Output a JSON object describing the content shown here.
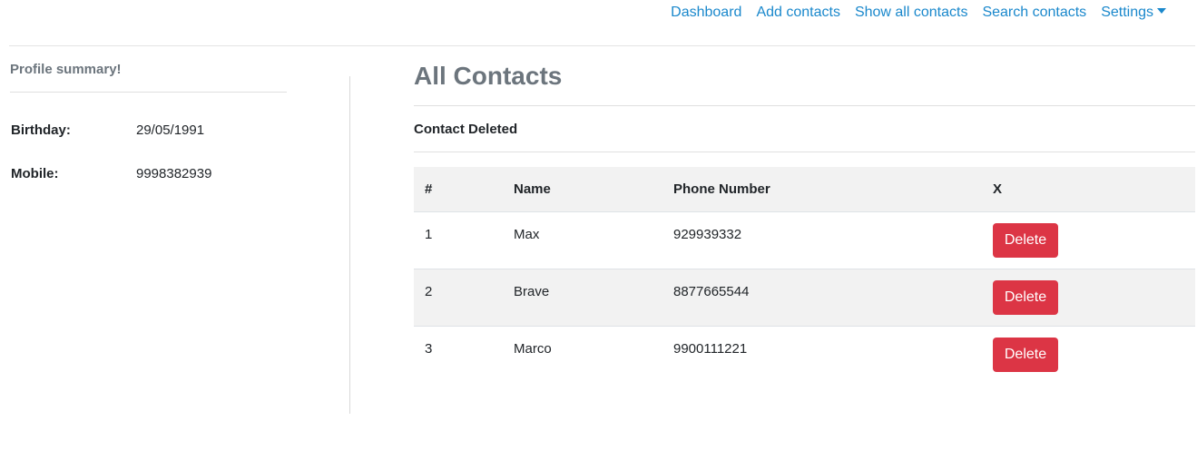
{
  "nav": {
    "items": [
      {
        "label": "Dashboard"
      },
      {
        "label": "Add contacts"
      },
      {
        "label": "Show all contacts"
      },
      {
        "label": "Search contacts"
      },
      {
        "label": "Settings"
      }
    ]
  },
  "sidebar": {
    "title": "Profile summary!",
    "birthday_label": "Birthday:",
    "birthday_value": "29/05/1991",
    "mobile_label": "Mobile:",
    "mobile_value": "9998382939"
  },
  "main": {
    "title": "All Contacts",
    "status": "Contact Deleted",
    "table": {
      "headers": [
        "#",
        "Name",
        "Phone Number",
        "X"
      ],
      "rows": [
        {
          "num": "1",
          "name": "Max",
          "phone": "929939332",
          "action": "Delete"
        },
        {
          "num": "2",
          "name": "Brave",
          "phone": "8877665544",
          "action": "Delete"
        },
        {
          "num": "3",
          "name": "Marco",
          "phone": "9900111221",
          "action": "Delete"
        }
      ]
    }
  },
  "colors": {
    "link": "#1a88cc",
    "danger": "#dc3545",
    "muted": "#6c757d"
  }
}
